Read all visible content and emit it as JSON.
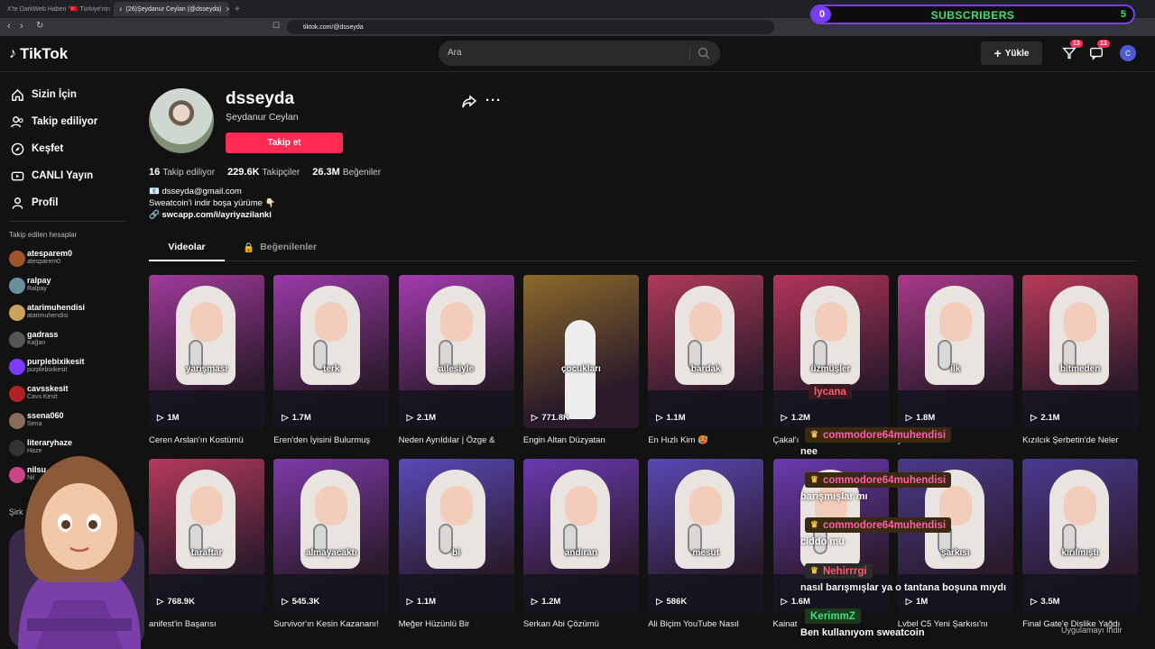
{
  "browser": {
    "tabs": [
      {
        "label": "X'te DarkWeb Haberi \"🇹🇷 Türkiye'nin",
        "active": false
      },
      {
        "label": "(26)Şeydanur Ceylan (@dsseyda)",
        "active": true
      }
    ],
    "new_tab": "+",
    "url": "tiktok.com/@dsseyda"
  },
  "subscribers": {
    "label": "SUBSCRIBERS",
    "current": "0",
    "goal": "5",
    "progress_fraction": 0.04,
    "accent": "#7a3cff",
    "text_color": "#39e07a"
  },
  "header": {
    "logo": "TikTok",
    "search_placeholder": "Ara",
    "upload_label": "Yükle",
    "inbox_badge": "13",
    "messages_badge": "13",
    "avatar_letter": "C"
  },
  "sidebar": {
    "nav": [
      {
        "label": "Sizin İçin",
        "icon": "home-icon"
      },
      {
        "label": "Takip ediliyor",
        "icon": "following-icon"
      },
      {
        "label": "Keşfet",
        "icon": "compass-icon"
      },
      {
        "label": "CANLI Yayın",
        "icon": "live-icon"
      },
      {
        "label": "Profil",
        "icon": "profile-icon"
      }
    ],
    "following_heading": "Takip edilen hesaplar",
    "following": [
      {
        "username": "atesparem0",
        "display": "atesparem0",
        "color": "#a0522d"
      },
      {
        "username": "ralpay",
        "display": "Ralpay",
        "color": "#6b8e9f"
      },
      {
        "username": "atarimuhendisi",
        "display": "atarimuhendisi",
        "color": "#c9a45a"
      },
      {
        "username": "gadrass",
        "display": "Kağan",
        "color": "#555"
      },
      {
        "username": "purplebixikesit",
        "display": "purplebixikesit",
        "color": "#7a3cff"
      },
      {
        "username": "cavsskesit",
        "display": "Cavs Kesit",
        "color": "#b22222"
      },
      {
        "username": "ssena060",
        "display": "Sena",
        "color": "#8b6b5c"
      },
      {
        "username": "literaryhaze",
        "display": "Haze",
        "color": "#333"
      },
      {
        "username": "nilsu",
        "display": "Nil",
        "color": "#c48"
      }
    ]
  },
  "profile": {
    "username": "dsseyda",
    "display_name": "Şeydanur Ceylan",
    "follow_label": "Takip et",
    "stats": [
      {
        "value": "16",
        "label": "Takip ediliyor"
      },
      {
        "value": "229.6K",
        "label": "Takipçiler"
      },
      {
        "value": "26.3M",
        "label": "Beğeniler"
      }
    ],
    "email": "📧 dsseyda@gmail.com",
    "bio": "Sweatcoin'i indir boşa yürüme 👇🏻",
    "link": "swcapp.com/i/ayriyazilanki",
    "tabs": {
      "videos": "Videolar",
      "liked": "Beğenilenler"
    }
  },
  "videos": [
    {
      "caption": "yarışması",
      "views": "1M",
      "title": "Ceren Arslan'ın Kostümü",
      "bg": "#a03a9a"
    },
    {
      "caption": "terk",
      "views": "1.7M",
      "title": "Eren'den İyisini Bulurmuş",
      "bg": "#9b3aa8"
    },
    {
      "caption": "ailesiyle",
      "views": "2.1M",
      "title": "Neden Ayrıldılar | Özge &",
      "bg": "#a43cb0"
    },
    {
      "caption": "çocukları",
      "views": "771.8K",
      "title": "Engin Altan Düzyatan",
      "bg": "#8c6a2a"
    },
    {
      "caption": "bardak",
      "views": "1.1M",
      "title": "En Hızlı Kim 🥵",
      "bg": "#b03a5a"
    },
    {
      "caption": "üzmüşler",
      "views": "1.2M",
      "title": "Çakal'ı",
      "bg": "#b4345a"
    },
    {
      "caption": "ilk",
      "views": "1.8M",
      "title": "yna Tilki",
      "bg": "#a83a8a"
    },
    {
      "caption": "bitmeden",
      "views": "2.1M",
      "title": "Kızılcık Şerbetin'de Neler",
      "bg": "#b83a5a"
    },
    {
      "caption": "taraftar",
      "views": "768.9K",
      "title": "anifest'in Başarısı",
      "bg": "#b43a5c"
    },
    {
      "caption": "almayacaktı",
      "views": "545.3K",
      "title": "Survivor'ın Kesin Kazananı!",
      "bg": "#7e3aa8"
    },
    {
      "caption": "bi",
      "views": "1.1M",
      "title": "Meğer Hüzünlü Bir",
      "bg": "#5a4ab8"
    },
    {
      "caption": "andıran",
      "views": "1.2M",
      "title": "Serkan Abi Çözümü",
      "bg": "#6a3ab0"
    },
    {
      "caption": "mesut",
      "views": "586K",
      "title": "Ali Biçim YouTube Nasıl",
      "bg": "#5a48b4"
    },
    {
      "caption": "",
      "views": "1.6M",
      "title": "Kainat",
      "bg": "#6a3ab0"
    },
    {
      "caption": "şarkısı",
      "views": "1M",
      "title": "Lvbel C5 Yeni Şarkısı'nı",
      "bg": "#4a3a8a"
    },
    {
      "caption": "kırılmıştı",
      "views": "3.5M",
      "title": "Final Gate'e Dislike Yağdı",
      "bg": "#4a3a90"
    }
  ],
  "chat": [
    {
      "name": "lycana",
      "message": "",
      "name_color": "#ff5a6e",
      "bg": "#3a1a22",
      "crown": false
    },
    {
      "name": "commodore64muhendisi",
      "message": "nee",
      "name_color": "#ff5fa8",
      "bg": "#3a2a10",
      "crown": true
    },
    {
      "name": "commodore64muhendisi",
      "message": "barışmışlar mı",
      "name_color": "#ff5fa8",
      "bg": "#3a2a10",
      "crown": true
    },
    {
      "name": "commodore64muhendisi",
      "message": "ciddo mu",
      "name_color": "#ff5fa8",
      "bg": "#3a2a10",
      "crown": true
    },
    {
      "name": "Nehirrrgi",
      "message": "nasıl barışmışlar ya o tantana boşuna mıydı",
      "name_color": "#ff5a6e",
      "bg": "#2a2a2a",
      "crown": true
    },
    {
      "name": "KerimmZ",
      "message": "Ben kullanıyom sweatcoin",
      "name_color": "#39e07a",
      "bg": "#1e3a1e",
      "crown": false
    }
  ],
  "get_app": "Uygulamayı İndir",
  "partial_sidebar_heading": "Şirk"
}
